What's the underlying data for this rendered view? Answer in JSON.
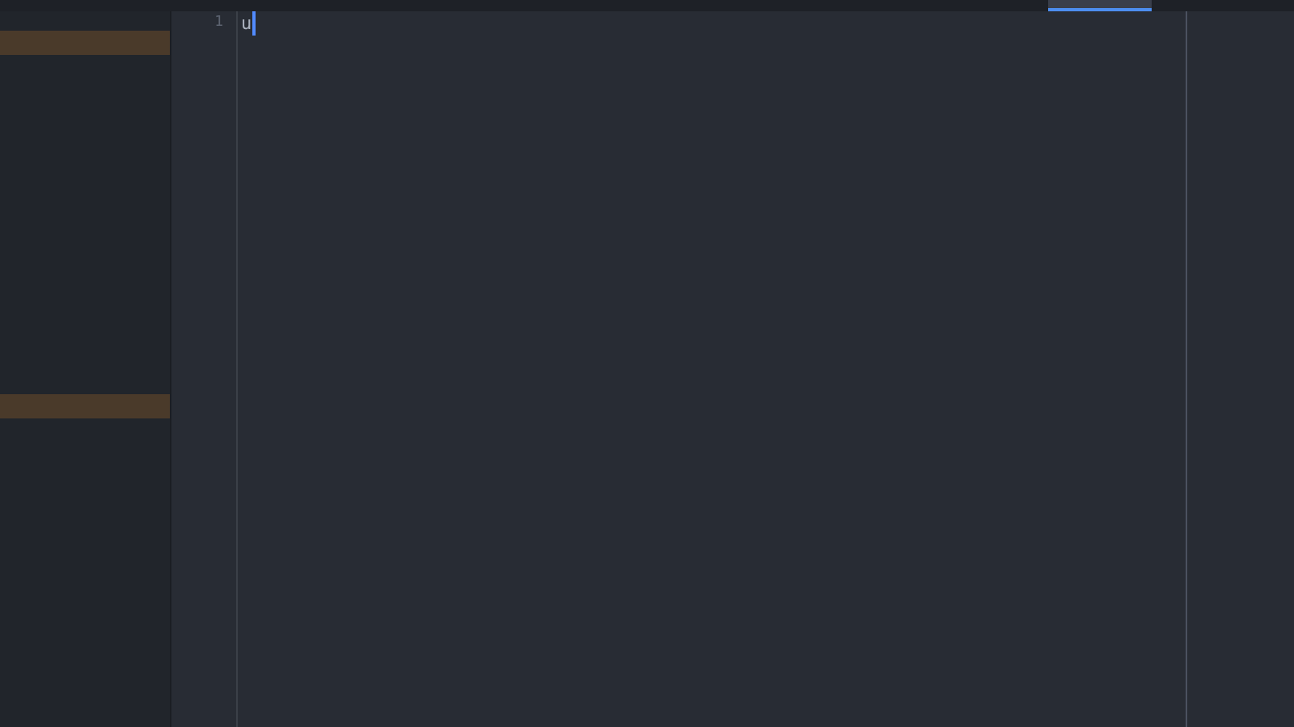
{
  "tabs": [
    {
      "selected": true
    }
  ],
  "sidebar": {
    "rows": [
      {
        "highlighted": true
      },
      {
        "highlighted": false
      },
      {
        "highlighted": false
      },
      {
        "highlighted": false
      },
      {
        "highlighted": false
      },
      {
        "highlighted": false
      },
      {
        "highlighted": false
      },
      {
        "highlighted": false
      },
      {
        "highlighted": false
      },
      {
        "highlighted": false
      },
      {
        "highlighted": false
      },
      {
        "highlighted": false
      },
      {
        "highlighted": false
      },
      {
        "highlighted": false
      },
      {
        "highlighted": false
      },
      {
        "highlighted": true
      },
      {
        "highlighted": false
      },
      {
        "highlighted": false
      },
      {
        "highlighted": false
      },
      {
        "highlighted": false
      },
      {
        "highlighted": false
      },
      {
        "highlighted": false
      },
      {
        "highlighted": false
      },
      {
        "highlighted": false
      },
      {
        "highlighted": false
      },
      {
        "highlighted": false
      },
      {
        "highlighted": false
      },
      {
        "highlighted": false
      }
    ]
  },
  "editor": {
    "lines": [
      {
        "number": "1",
        "text": "u",
        "cursor": true
      }
    ]
  }
}
